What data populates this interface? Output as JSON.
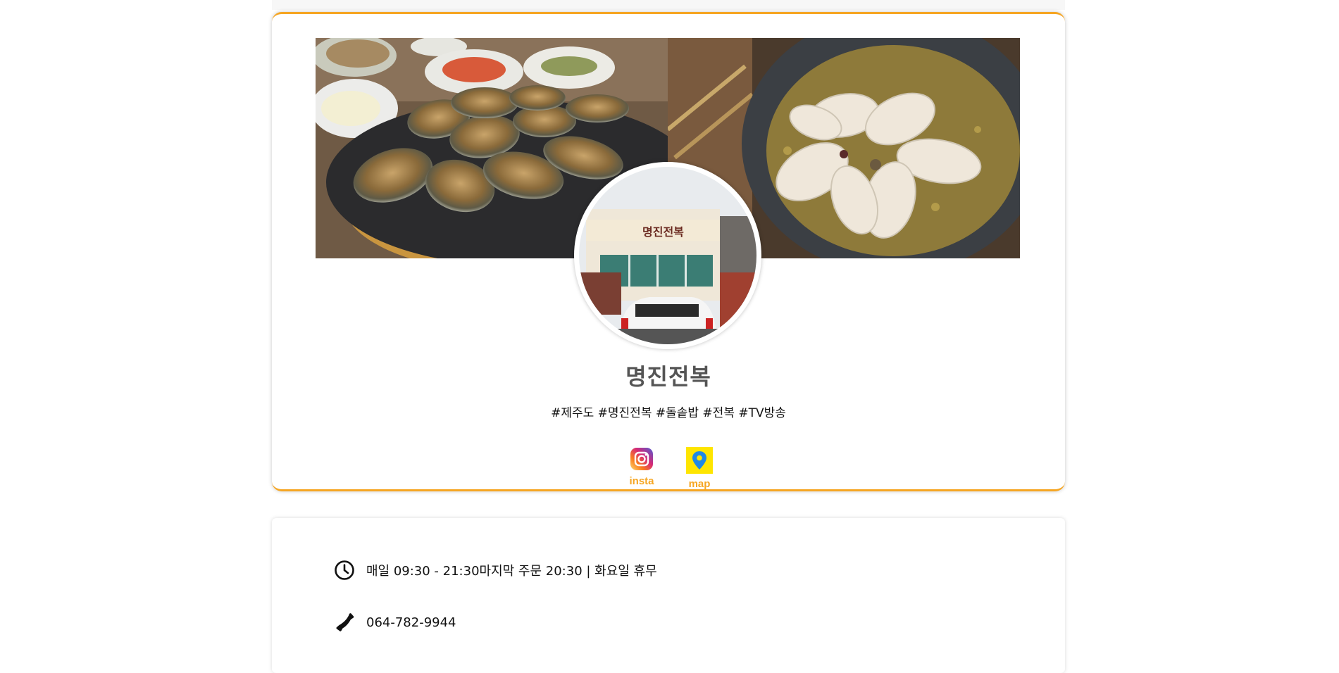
{
  "profile": {
    "name": "명진전복",
    "tags": "#제주도 #명진전복 #돌솥밥 #전복 #TV방송",
    "banner_images": [
      "grilled-abalone-plate-photo",
      "abalone-stone-pot-rice-photo"
    ],
    "avatar_image": "restaurant-storefront-photo",
    "links": [
      {
        "label": "insta",
        "icon": "instagram-icon"
      },
      {
        "label": "map",
        "icon": "map-pin-icon"
      }
    ]
  },
  "info": {
    "hours": "매일 09:30 - 21:30마지막 주문 20:30 | 화요일 휴무",
    "phone": "064-782-9944"
  },
  "colors": {
    "accent": "#f6a623",
    "map_bg": "#fee500",
    "map_pin": "#1e88e5"
  }
}
